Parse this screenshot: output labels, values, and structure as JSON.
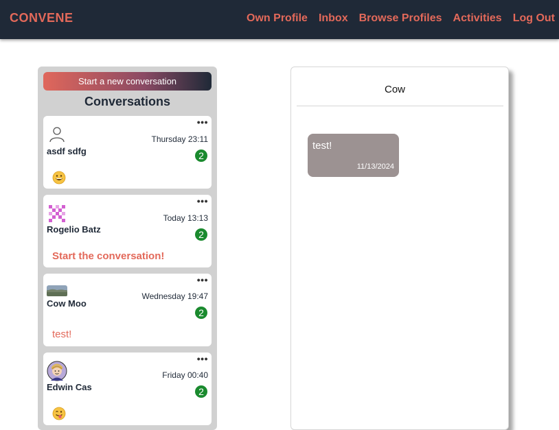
{
  "nav": {
    "brand": "CONVENE",
    "links": [
      "Own Profile",
      "Inbox",
      "Browse Profiles",
      "Activities",
      "Log Out"
    ]
  },
  "sidebar": {
    "new_button": "Start a new conversation",
    "title": "Conversations",
    "menu_glyph": "•••",
    "conversations": [
      {
        "name": "asdf sdfg",
        "time": "Thursday 23:11",
        "unread": "2",
        "preview": "",
        "preview_icon": "grinning-emoji-icon",
        "avatar_icon": "default-user-icon"
      },
      {
        "name": "Rogelio Batz",
        "time": "Today 13:13",
        "unread": "2",
        "preview": "Start the conversation!",
        "avatar_icon": "pixel-pattern-avatar"
      },
      {
        "name": "Cow Moo",
        "time": "Wednesday 19:47",
        "unread": "2",
        "preview": "test!",
        "avatar_icon": "landscape-photo-avatar"
      },
      {
        "name": "Edwin Cas",
        "time": "Friday 00:40",
        "unread": "2",
        "preview": "",
        "preview_icon": "winking-tongue-emoji-icon",
        "avatar_icon": "cartoon-person-avatar"
      }
    ]
  },
  "chat": {
    "title": "Cow",
    "messages": [
      {
        "text": "test!",
        "date": "11/13/2024"
      }
    ]
  },
  "colors": {
    "navbar_bg": "#1f2937",
    "accent": "#e3695a",
    "badge": "#1a8a2e",
    "sidebar_bg": "#d1d1d1",
    "bubble_bg": "#9c9292"
  }
}
